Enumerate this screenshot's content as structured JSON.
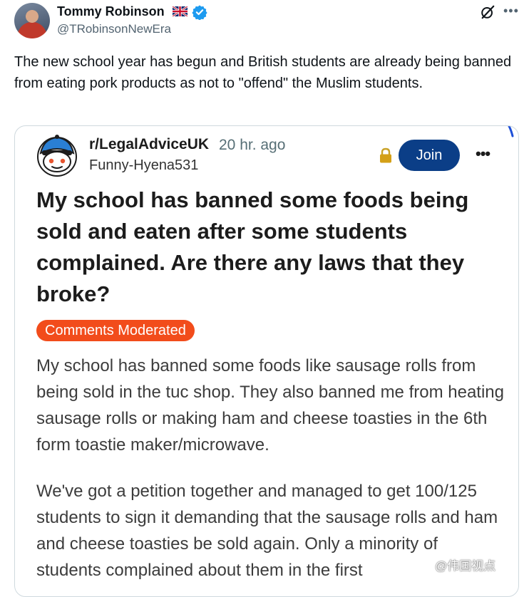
{
  "tweet": {
    "author_name": "Tommy Robinson",
    "handle": "@TRobinsonNewEra",
    "text": "The new school year has begun and British students are already being banned from eating pork products as not to \"offend\" the Muslim students."
  },
  "icons": {
    "flag": "uk-flag-icon",
    "verified": "verified-badge-icon",
    "grok": "grok-icon",
    "more": "more-icon",
    "lock": "lock-icon",
    "avatar": "snoo-avatar-icon"
  },
  "reddit_card": {
    "subreddit": "r/LegalAdviceUK",
    "time": "20 hr. ago",
    "username": "Funny-Hyena531",
    "join_label": "Join",
    "title": "My school has banned some foods being sold and eaten after some students complained. Are there any laws that they broke?",
    "badge": "Comments Moderated",
    "body": [
      "My school has banned some foods like sausage rolls from being sold in the tuc shop. They also banned me from heating sausage rolls or making ham and cheese toasties in the 6th form toastie maker/microwave.",
      "We've got a petition together and managed to get 100/125 students to sign it demanding that the sausage rolls and ham and cheese toasties be sold again. Only a minority of students complained about them in the first"
    ]
  },
  "watermark": "@伟国视点",
  "colors": {
    "join": "#0b3e87",
    "badge": "#f24c1b",
    "verified": "#1d9bf0"
  }
}
